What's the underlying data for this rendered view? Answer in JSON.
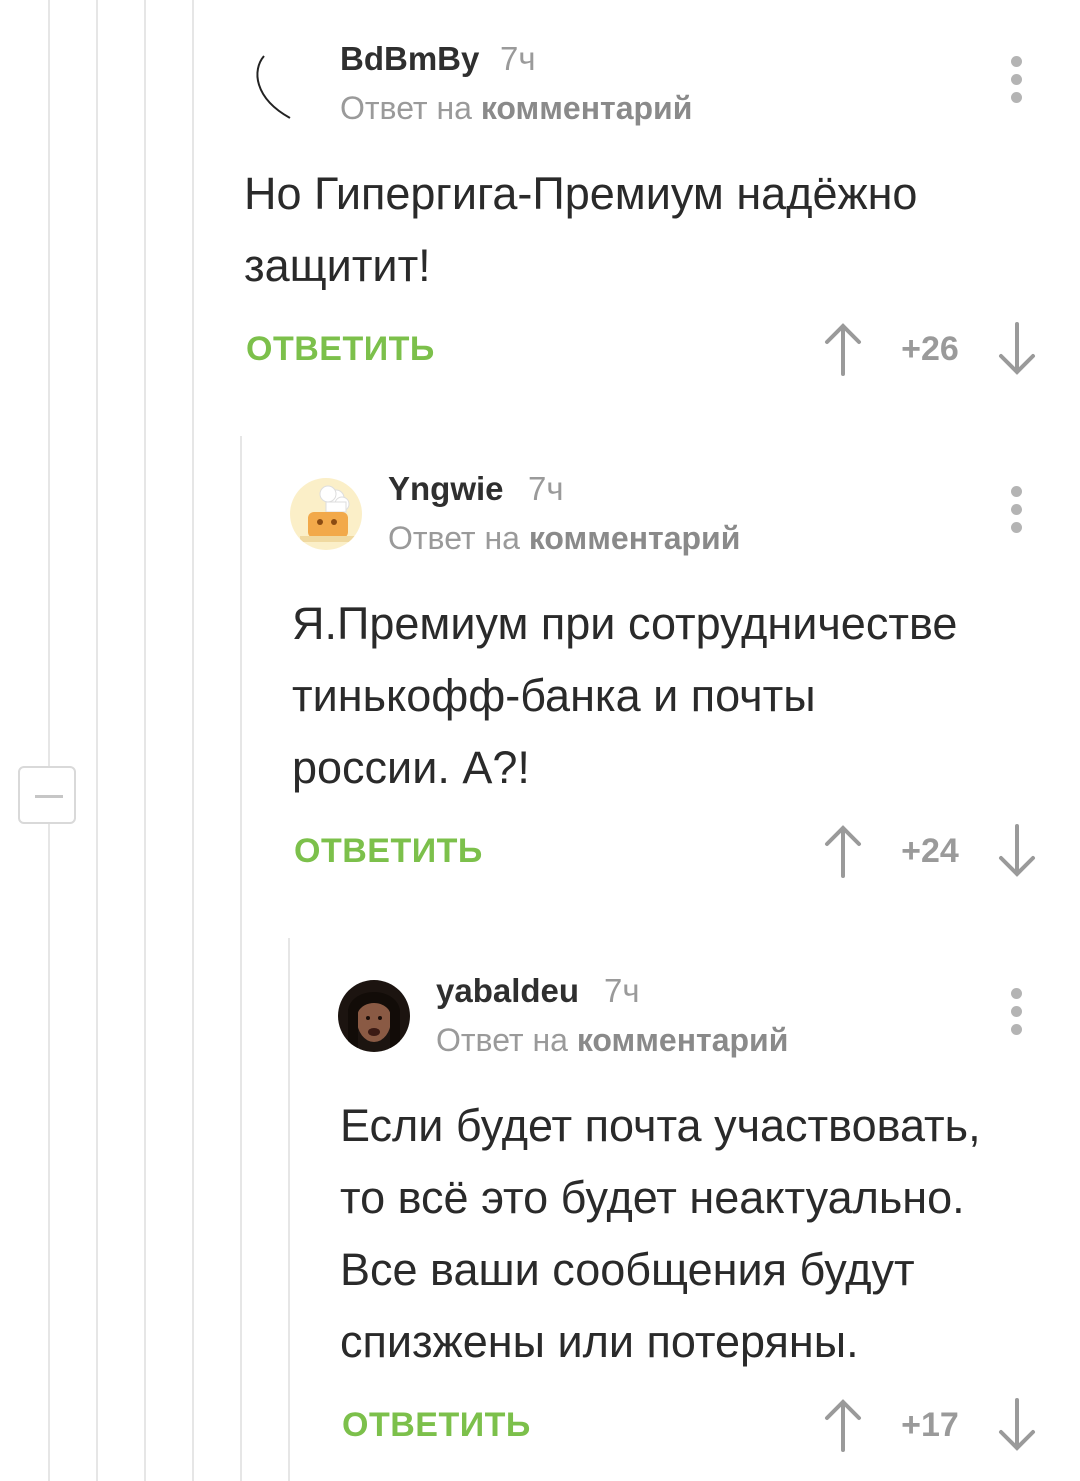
{
  "comments": [
    {
      "username": "BdBmBy",
      "time": "7ч",
      "reply_prefix": "Ответ на",
      "reply_target": "комментарий",
      "text_lines": [
        "Но Гипергига-Премиум надёжно",
        "защитит!"
      ],
      "reply_label": "ОТВЕТИТЬ",
      "score": "+26"
    },
    {
      "username": "Yngwie",
      "time": "7ч",
      "reply_prefix": "Ответ на",
      "reply_target": "комментарий",
      "text_lines": [
        "Я.Премиум при сотрудничестве",
        "тинькофф-банка и почты",
        "россии. А?!"
      ],
      "reply_label": "ОТВЕТИТЬ",
      "score": "+24"
    },
    {
      "username": "yabaldeu",
      "time": "7ч",
      "reply_prefix": "Ответ на",
      "reply_target": "комментарий",
      "text_lines": [
        "Если будет почта участвовать,",
        "то всё это будет неактуально.",
        "Все ваши сообщения будут",
        "спизжены или потеряны."
      ],
      "reply_label": "ОТВЕТИТЬ",
      "score": "+17"
    }
  ],
  "colors": {
    "reply_green": "#7cc04b",
    "muted_gray": "#9a9a9a",
    "thread_line": "#e6e6e6"
  },
  "icons": [
    "kebab-menu-icon",
    "arrow-up-icon",
    "arrow-down-icon",
    "collapse-minus-icon"
  ]
}
